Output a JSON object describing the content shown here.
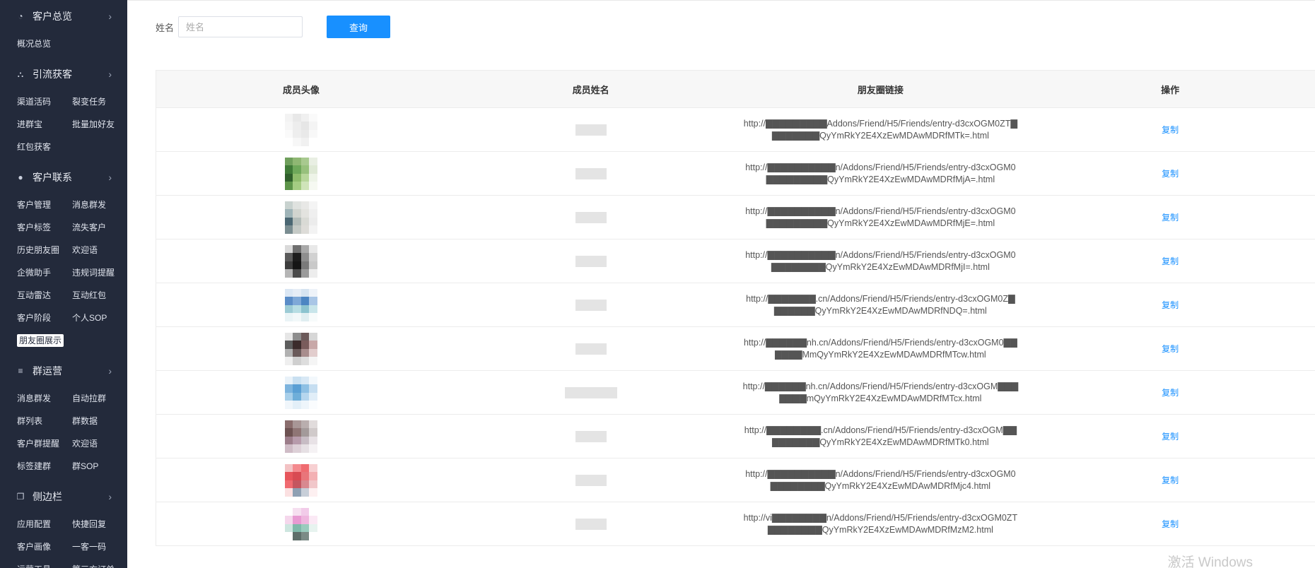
{
  "sidebar": {
    "groups": [
      {
        "title": "客户总览",
        "icon": "pie-chart-icon",
        "items": [
          "概况总览"
        ]
      },
      {
        "title": "引流获客",
        "icon": "sitemap-icon",
        "items": [
          "渠道活码",
          "裂变任务",
          "进群宝",
          "批量加好友",
          "红包获客"
        ]
      },
      {
        "title": "客户联系",
        "icon": "user-icon",
        "items": [
          "客户管理",
          "消息群发",
          "客户标签",
          "流失客户",
          "历史朋友圈",
          "欢迎语",
          "企微助手",
          "违规词提醒",
          "互动雷达",
          "互动红包",
          "客户阶段",
          "个人SOP",
          "朋友圈展示"
        ]
      },
      {
        "title": "群运营",
        "icon": "menu-lines-icon",
        "items": [
          "消息群发",
          "自动拉群",
          "群列表",
          "群数据",
          "客户群提醒",
          "欢迎语",
          "标签建群",
          "群SOP"
        ]
      },
      {
        "title": "侧边栏",
        "icon": "window-icon",
        "items": [
          "应用配置",
          "快捷回复",
          "客户画像",
          "一客一码",
          "运营工具",
          "第三方订单"
        ]
      }
    ],
    "active_item": "朋友圈展示"
  },
  "search": {
    "label": "姓名",
    "placeholder": "姓名",
    "value": "",
    "button": "查询"
  },
  "table": {
    "headers": [
      "成员头像",
      "成员姓名",
      "朋友圈链接",
      "操作"
    ],
    "rows": [
      {
        "link": "http://▇▇▇▇▇▇▇▇▇Addons/Friend/H5/Friends/entry-d3cxOGM0ZT▇▇▇▇▇▇▇▇QyYmRkY2E4XzEwMDAwMDRfMTk=.html",
        "action": "复制"
      },
      {
        "link": "http://▇▇▇▇▇▇▇▇▇▇n/Addons/Friend/H5/Friends/entry-d3cxOGM0▇▇▇▇▇▇▇▇▇QyYmRkY2E4XzEwMDAwMDRfMjA=.html",
        "action": "复制"
      },
      {
        "link": "http://▇▇▇▇▇▇▇▇▇▇n/Addons/Friend/H5/Friends/entry-d3cxOGM0▇▇▇▇▇▇▇▇▇QyYmRkY2E4XzEwMDAwMDRfMjE=.html",
        "action": "复制"
      },
      {
        "link": "http://▇▇▇▇▇▇▇▇▇▇n/Addons/Friend/H5/Friends/entry-d3cxOGM0▇▇▇▇▇▇▇▇QyYmRkY2E4XzEwMDAwMDRfMjI=.html",
        "action": "复制"
      },
      {
        "link": "http://▇▇▇▇▇▇▇.cn/Addons/Friend/H5/Friends/entry-d3cxOGM0Z▇▇▇▇▇▇▇QyYmRkY2E4XzEwMDAwMDRfNDQ=.html",
        "action": "复制"
      },
      {
        "link": "http://▇▇▇▇▇▇nh.cn/Addons/Friend/H5/Friends/entry-d3cxOGM0▇▇▇▇▇▇MmQyYmRkY2E4XzEwMDAwMDRfMTcw.html",
        "action": "复制"
      },
      {
        "link": "http://▇▇▇▇▇▇nh.cn/Addons/Friend/H5/Friends/entry-d3cxOGM▇▇▇▇▇▇▇mQyYmRkY2E4XzEwMDAwMDRfMTcx.html",
        "action": "复制"
      },
      {
        "link": "http://▇▇▇▇▇▇▇▇.cn/Addons/Friend/H5/Friends/entry-d3cxOGM▇▇▇▇▇▇▇▇▇QyYmRkY2E4XzEwMDAwMDRfMTk0.html",
        "action": "复制"
      },
      {
        "link": "http://▇▇▇▇▇▇▇▇▇▇n/Addons/Friend/H5/Friends/entry-d3cxOGM0▇▇▇▇▇▇▇▇QyYmRkY2E4XzEwMDAwMDRfMjc4.html",
        "action": "复制"
      },
      {
        "link": "http://vi▇▇▇▇▇▇▇▇n/Addons/Friend/H5/Friends/entry-d3cxOGM0ZT▇▇▇▇▇▇▇▇QyYmRkY2E4XzEwMDAwMDRfMzM2.html",
        "action": "复制"
      }
    ]
  },
  "avatars": [
    [
      "#f3f3f3",
      "#e8e8e8",
      "#f0f0f0",
      "#fafafa",
      "#f6f6f6",
      "#ededed",
      "#e6e6e6",
      "#f4f4f4",
      "#fafafa",
      "#eeeeee",
      "#e9e9e9",
      "#f8f8f8",
      "#ffffff",
      "#f7f7f7",
      "#f1f1f1",
      "#ffffff"
    ],
    [
      "#6f9f5c",
      "#8fb773",
      "#a8c98f",
      "#e9efe3",
      "#3f7a37",
      "#6ea85a",
      "#97c07c",
      "#dfe9d6",
      "#2f5f2b",
      "#8dbb6b",
      "#b7d69a",
      "#eef4e8",
      "#5d9449",
      "#a4cc82",
      "#cfe4b9",
      "#f6f9f2"
    ],
    [
      "#c8d2cf",
      "#dfe2df",
      "#e8e8e6",
      "#f4f4f4",
      "#9fb4b8",
      "#d1d4cf",
      "#e3e3df",
      "#efefef",
      "#4b6773",
      "#b3bcb9",
      "#d9dad5",
      "#ececec",
      "#7a8d91",
      "#c5cac6",
      "#dddcd8",
      "#f3f3f3"
    ],
    [
      "#dadada",
      "#6f6f6f",
      "#a9a9a9",
      "#e8e8e8",
      "#5a5a5a",
      "#1d1d1d",
      "#8e8e8e",
      "#d1d1d1",
      "#3d3d3d",
      "#151515",
      "#7a7a7a",
      "#c9c9c9",
      "#b5b5b5",
      "#4b4b4b",
      "#9a9a9a",
      "#ededed"
    ],
    [
      "#dbe7f4",
      "#e6edf6",
      "#d6e4f1",
      "#eef3f9",
      "#5a8cc7",
      "#7ea8d7",
      "#4c85c2",
      "#a9c6e6",
      "#9ccbd5",
      "#b7dde3",
      "#8cc3cf",
      "#c8e5ea",
      "#eaf4f6",
      "#f2f8f9",
      "#e0eef1",
      "#f7fbfb"
    ],
    [
      "#e6e6e6",
      "#8d8d8d",
      "#6c5a5a",
      "#d7d7d7",
      "#5d5d5d",
      "#3b2b2b",
      "#7a5c5c",
      "#c8a8a8",
      "#b1b1b1",
      "#6a5a5a",
      "#a88d8d",
      "#e2cdcd",
      "#efefef",
      "#cfcfcf",
      "#dddddd",
      "#f5f5f5"
    ],
    [
      "#e9f2f9",
      "#c9e0f1",
      "#d8e8f5",
      "#f3f8fc",
      "#7db4de",
      "#5a9fd4",
      "#8ec0e4",
      "#c6def1",
      "#a8cfea",
      "#6faed9",
      "#b6d6ee",
      "#e1eef8",
      "#f0f6fb",
      "#e3eff8",
      "#eef5fb",
      "#fafcfe"
    ],
    [
      "#8a6d6d",
      "#a89696",
      "#b9aeae",
      "#e1dcdc",
      "#6d5252",
      "#8f7575",
      "#a39a9a",
      "#d0caca",
      "#9c7d8a",
      "#b79bab",
      "#c7bcc4",
      "#e8e2e6",
      "#cfbcc6",
      "#ddd0d7",
      "#e6e0e4",
      "#f5f2f4"
    ],
    [
      "#f3c2c4",
      "#f48a8e",
      "#ef6b70",
      "#f7d0d2",
      "#e7555b",
      "#d84a52",
      "#e9757a",
      "#f3b0b3",
      "#f06a70",
      "#c45660",
      "#d88990",
      "#f1c7ca",
      "#fbe0e1",
      "#8fa0b3",
      "#c7ced8",
      "#fdf0f1"
    ],
    [
      "#ffffff",
      "#f6dff0",
      "#f2cbe9",
      "#ffffff",
      "#f5d7ec",
      "#e89ad2",
      "#efb6de",
      "#fbe9f5",
      "#cde6df",
      "#7fb9aa",
      "#9acbbd",
      "#e7f3ef",
      "#ffffff",
      "#5e6e6a",
      "#7b8b86",
      "#ffffff"
    ]
  ],
  "watermark": "激活 Windows"
}
